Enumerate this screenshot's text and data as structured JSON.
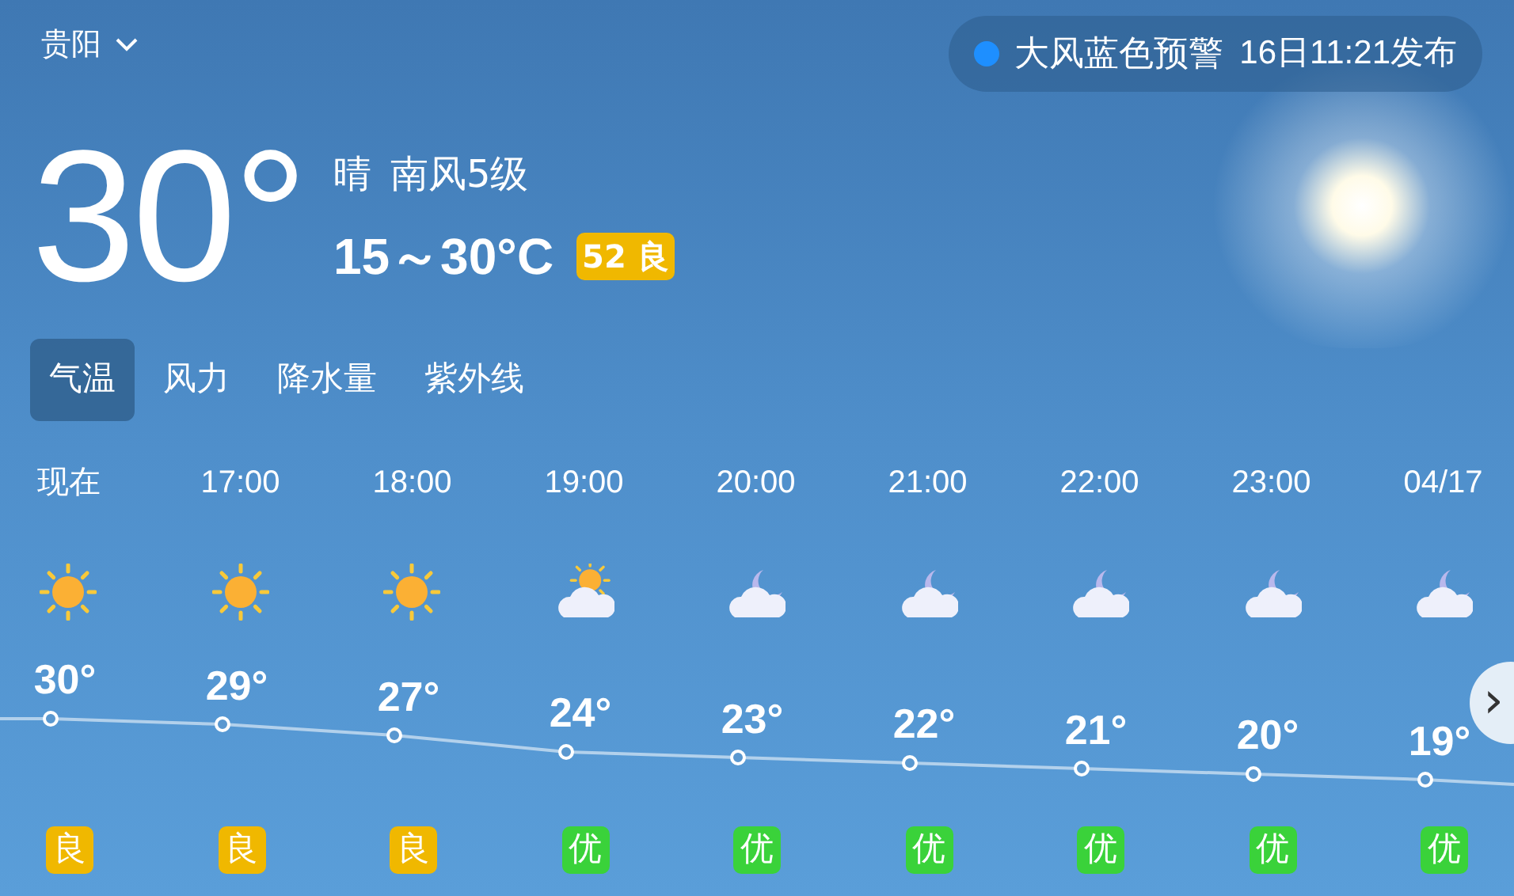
{
  "city": {
    "name": "贵阳"
  },
  "alert": {
    "color": "#1e8fff",
    "title": "大风蓝色预警",
    "time": "16日11:21发布"
  },
  "current": {
    "temperature": "30°",
    "condition": "晴",
    "wind": "南风5级",
    "range": "15～30°C",
    "aqi": {
      "text": "52 良",
      "color": "#f0b800"
    }
  },
  "tabs": [
    {
      "label": "气温",
      "selected": true
    },
    {
      "label": "风力",
      "selected": false
    },
    {
      "label": "降水量",
      "selected": false
    },
    {
      "label": "紫外线",
      "selected": false
    }
  ],
  "hourly": [
    {
      "time": "现在",
      "kind": "sun",
      "temperature": "30°",
      "aqi": {
        "text": "良",
        "color": "#f0b800"
      }
    },
    {
      "time": "17:00",
      "kind": "sun",
      "temperature": "29°",
      "aqi": {
        "text": "良",
        "color": "#f0b800"
      }
    },
    {
      "time": "18:00",
      "kind": "sun",
      "temperature": "27°",
      "aqi": {
        "text": "良",
        "color": "#f0b800"
      }
    },
    {
      "time": "19:00",
      "kind": "sun-cloud",
      "temperature": "24°",
      "aqi": {
        "text": "优",
        "color": "#3ad23a"
      }
    },
    {
      "time": "20:00",
      "kind": "moon-cloud",
      "temperature": "23°",
      "aqi": {
        "text": "优",
        "color": "#3ad23a"
      }
    },
    {
      "time": "21:00",
      "kind": "moon-cloud",
      "temperature": "22°",
      "aqi": {
        "text": "优",
        "color": "#3ad23a"
      }
    },
    {
      "time": "22:00",
      "kind": "moon-cloud",
      "temperature": "21°",
      "aqi": {
        "text": "优",
        "color": "#3ad23a"
      }
    },
    {
      "time": "23:00",
      "kind": "moon-cloud",
      "temperature": "20°",
      "aqi": {
        "text": "优",
        "color": "#3ad23a"
      }
    },
    {
      "time": "04/17",
      "kind": "moon-cloud",
      "temperature": "19°",
      "aqi": {
        "text": "优",
        "color": "#3ad23a"
      }
    }
  ],
  "next_button": {
    "label": "›"
  }
}
